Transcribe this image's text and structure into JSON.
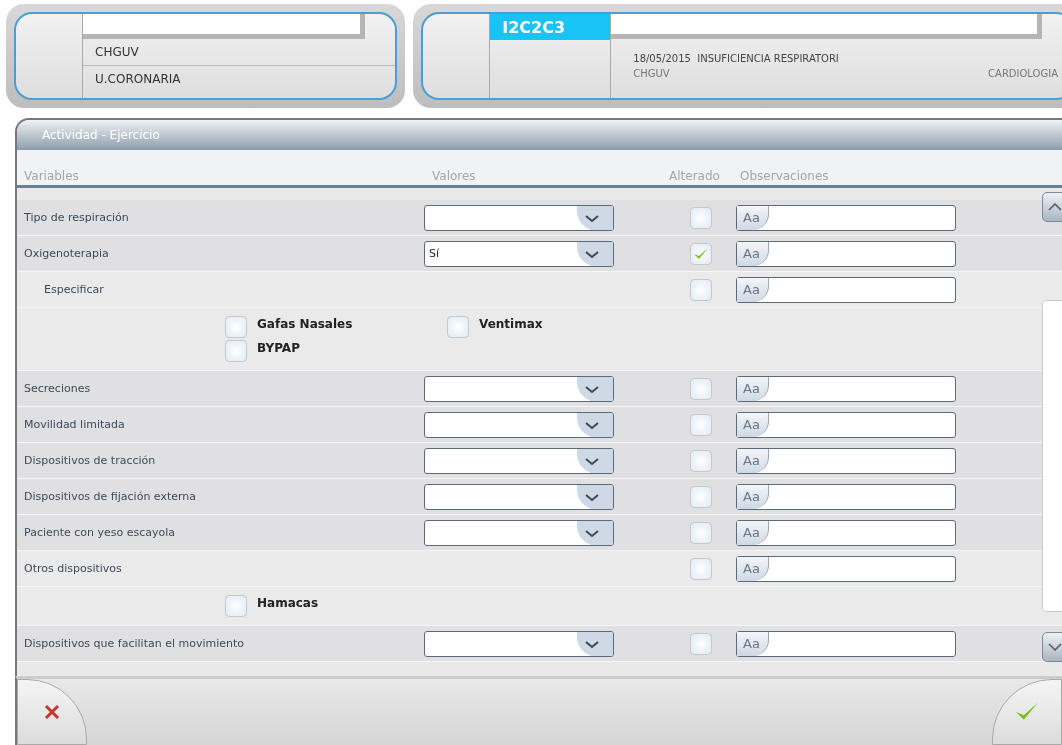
{
  "patient_card": {
    "lines": [
      "CHGUV",
      "U.CORONARIA"
    ]
  },
  "episode_card": {
    "code": "I2C2C3",
    "date": "18/05/2015",
    "diagnosis": "INSUFICIENCIA RESPIRATORI",
    "center": "CHGUV",
    "service": "CARDIOLOGIA"
  },
  "panel": {
    "title": "Actividad - Ejercicio",
    "columns": [
      "Variables",
      "Valores",
      "Alterado",
      "Observaciones"
    ],
    "rows": [
      {
        "kind": "select",
        "label": "Tipo de respiración",
        "value": "",
        "altered": false,
        "obs_hint": "Aa"
      },
      {
        "kind": "select",
        "label": "Oxigenoterapia",
        "value": "Sí",
        "altered": true,
        "obs_hint": "Aa"
      },
      {
        "kind": "subcheck",
        "label": "Especificar",
        "altered": false,
        "obs_hint": "Aa"
      },
      {
        "kind": "options",
        "options": [
          {
            "label": "Gafas Nasales",
            "checked": false
          },
          {
            "label": "Ventimax",
            "checked": false
          },
          {
            "label": "BYPAP",
            "checked": false
          }
        ]
      },
      {
        "kind": "select",
        "label": "Secreciones",
        "value": "",
        "altered": false,
        "obs_hint": "Aa"
      },
      {
        "kind": "select",
        "label": "Movilidad limitada",
        "value": "",
        "altered": false,
        "obs_hint": "Aa"
      },
      {
        "kind": "select",
        "label": "Dispositivos de tracción",
        "value": "",
        "altered": false,
        "obs_hint": "Aa"
      },
      {
        "kind": "select",
        "label": "Dispositivos de fijación externa",
        "value": "",
        "altered": false,
        "obs_hint": "Aa"
      },
      {
        "kind": "select",
        "label": "Paciente con yeso escayola",
        "value": "",
        "altered": false,
        "obs_hint": "Aa"
      },
      {
        "kind": "check",
        "label": "Otros dispositivos",
        "altered": false,
        "obs_hint": "Aa"
      },
      {
        "kind": "options",
        "options": [
          {
            "label": "Hamacas",
            "checked": false
          }
        ]
      },
      {
        "kind": "select",
        "label": "Dispositivos que facilitan el movimiento",
        "value": "",
        "altered": false,
        "obs_hint": "Aa"
      }
    ]
  }
}
